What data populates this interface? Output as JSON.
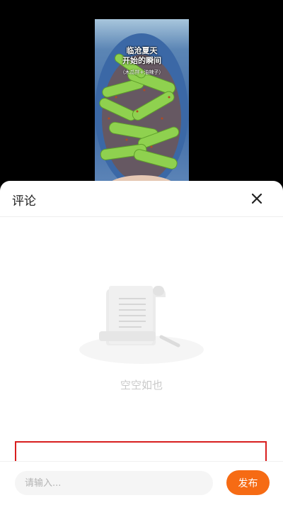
{
  "video": {
    "overlay_title_line1": "临沧夏天",
    "overlay_title_line2": "开始的瞬间",
    "overlay_subtitle": "（木瓜拌+油辣子）"
  },
  "comments_panel": {
    "title": "评论",
    "close_icon": "close-icon",
    "empty_text": "空空如也",
    "empty_illustration": "empty-document-icon"
  },
  "input_bar": {
    "placeholder": "请输入...",
    "value": "",
    "publish_label": "发布"
  },
  "colors": {
    "accent": "#f66b14",
    "highlight": "#d81e1e"
  }
}
